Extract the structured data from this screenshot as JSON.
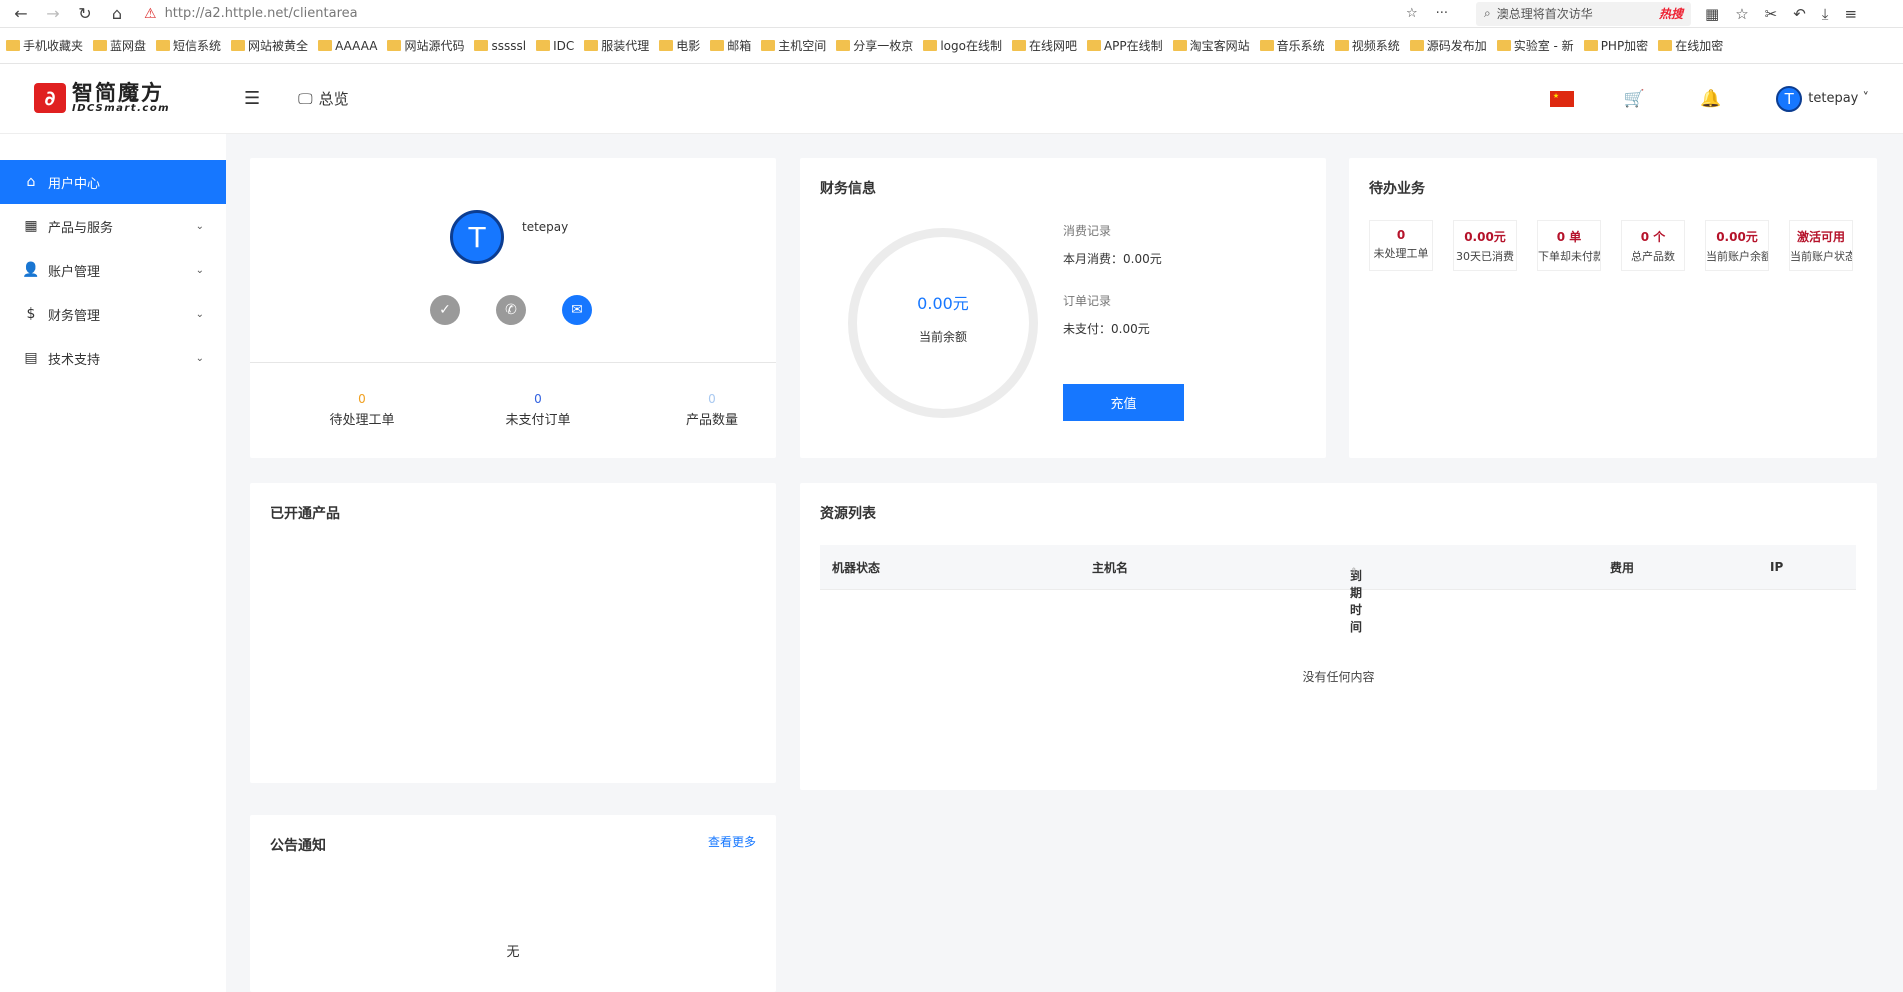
{
  "browser": {
    "url": "http://a2.httple.net/clientarea",
    "search_text": "澳总理将首次访华",
    "search_brand": "热搜"
  },
  "bookmarks": [
    "手机收藏夹",
    "蓝网盘",
    "短信系统",
    "网站被黄全",
    "AAAAA",
    "网站源代码",
    "sssssl",
    "IDC",
    "服装代理",
    "电影",
    "邮箱",
    "主机空间",
    "分享一枚京",
    "logo在线制",
    "在线网吧",
    "APP在线制",
    "淘宝客网站",
    "音乐系统",
    "视频系统",
    "源码发布加",
    "实验室 - 新",
    "PHP加密",
    "在线加密"
  ],
  "header": {
    "logo_cn": "智简魔方",
    "logo_en": "IDCSmart.com",
    "overview_label": "总览",
    "username": "tetepay"
  },
  "sidebar": {
    "items": [
      {
        "label": "用户中心"
      },
      {
        "label": "产品与服务"
      },
      {
        "label": "账户管理"
      },
      {
        "label": "财务管理"
      },
      {
        "label": "技术支持"
      }
    ]
  },
  "profile": {
    "avatar_letter": "T",
    "name": "tetepay",
    "stats": [
      {
        "value": "0",
        "label": "待处理工单",
        "color": "#f0a020"
      },
      {
        "value": "0",
        "label": "未支付订单",
        "color": "#3060e0"
      },
      {
        "value": "0",
        "label": "产品数量",
        "color": "#a8c8f0"
      }
    ]
  },
  "finance": {
    "title": "财务信息",
    "balance": "0.00元",
    "balance_label": "当前余额",
    "consume_title": "消费记录",
    "consume_month": "本月消费：0.00元",
    "order_title": "订单记录",
    "unpaid": "未支付：0.00元",
    "charge_button": "充值"
  },
  "todo": {
    "title": "待办业务",
    "items": [
      {
        "value": "0",
        "label": "未处理工单"
      },
      {
        "value": "0.00元",
        "label": "30天已消费"
      },
      {
        "value": "0 单",
        "label": "下单却未付款"
      },
      {
        "value": "0 个",
        "label": "总产品数"
      },
      {
        "value": "0.00元",
        "label": "当前账户余额"
      },
      {
        "value": "激活可用",
        "label": "当前账户状态"
      }
    ]
  },
  "products": {
    "title": "已开通产品"
  },
  "resources": {
    "title": "资源列表",
    "columns": [
      "机器状态",
      "主机名",
      "到期时间",
      "费用",
      "IP"
    ],
    "empty": "没有任何内容"
  },
  "notice": {
    "title": "公告通知",
    "more": "查看更多",
    "empty": "无"
  },
  "colors": {
    "primary": "#1677ff",
    "todo_value": "#b5122a"
  }
}
